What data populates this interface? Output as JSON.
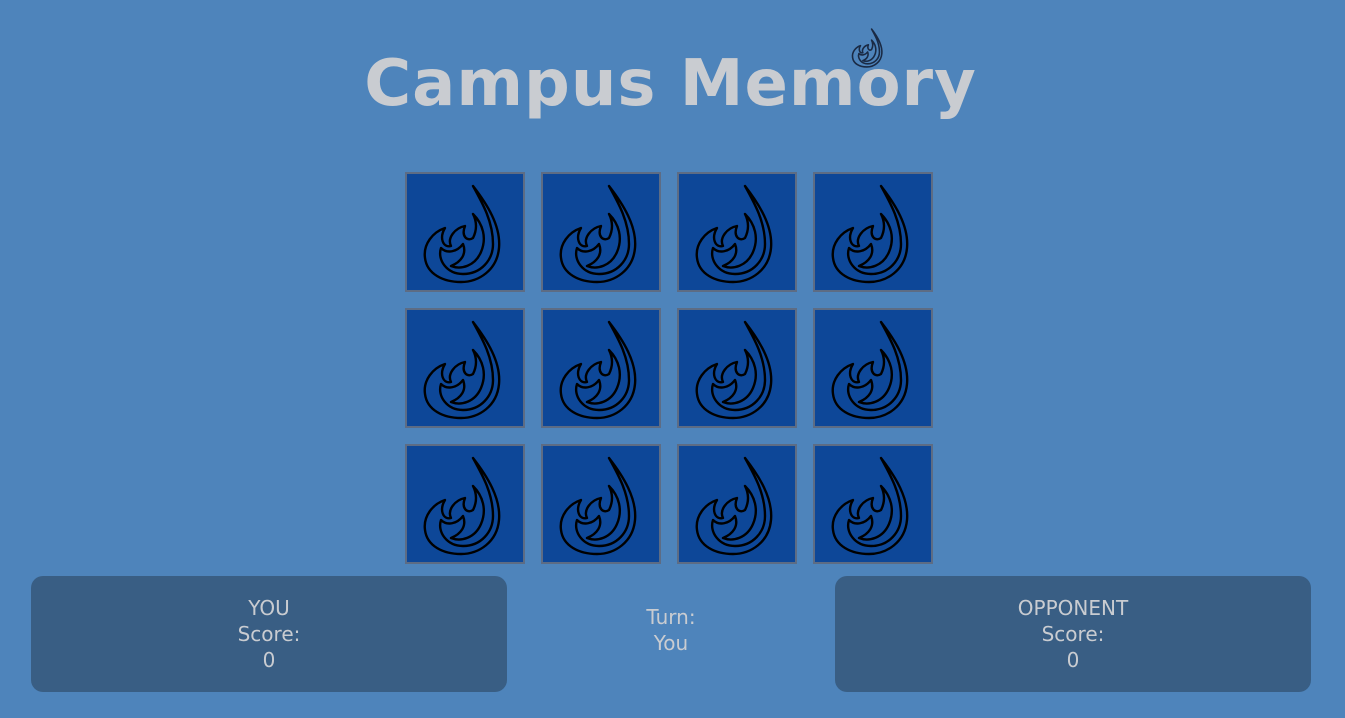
{
  "header": {
    "title": "Campus Memory",
    "logo_icon": "flame-icon"
  },
  "board": {
    "rows": 3,
    "columns": 4,
    "cards": [
      {
        "state": "face-down",
        "icon": "flame-icon"
      },
      {
        "state": "face-down",
        "icon": "flame-icon"
      },
      {
        "state": "face-down",
        "icon": "flame-icon"
      },
      {
        "state": "face-down",
        "icon": "flame-icon"
      },
      {
        "state": "face-down",
        "icon": "flame-icon"
      },
      {
        "state": "face-down",
        "icon": "flame-icon"
      },
      {
        "state": "face-down",
        "icon": "flame-icon"
      },
      {
        "state": "face-down",
        "icon": "flame-icon"
      },
      {
        "state": "face-down",
        "icon": "flame-icon"
      },
      {
        "state": "face-down",
        "icon": "flame-icon"
      },
      {
        "state": "face-down",
        "icon": "flame-icon"
      },
      {
        "state": "face-down",
        "icon": "flame-icon"
      }
    ]
  },
  "players": {
    "you": {
      "name": "YOU",
      "score_label": "Score:",
      "score": "0"
    },
    "opponent": {
      "name": "OPPONENT",
      "score_label": "Score:",
      "score": "0"
    }
  },
  "turn": {
    "label": "Turn:",
    "value": "You"
  },
  "colors": {
    "background": "#4e84bb",
    "card_back": "#0d4798",
    "panel": "#395e84",
    "text": "#c9ccd1"
  }
}
